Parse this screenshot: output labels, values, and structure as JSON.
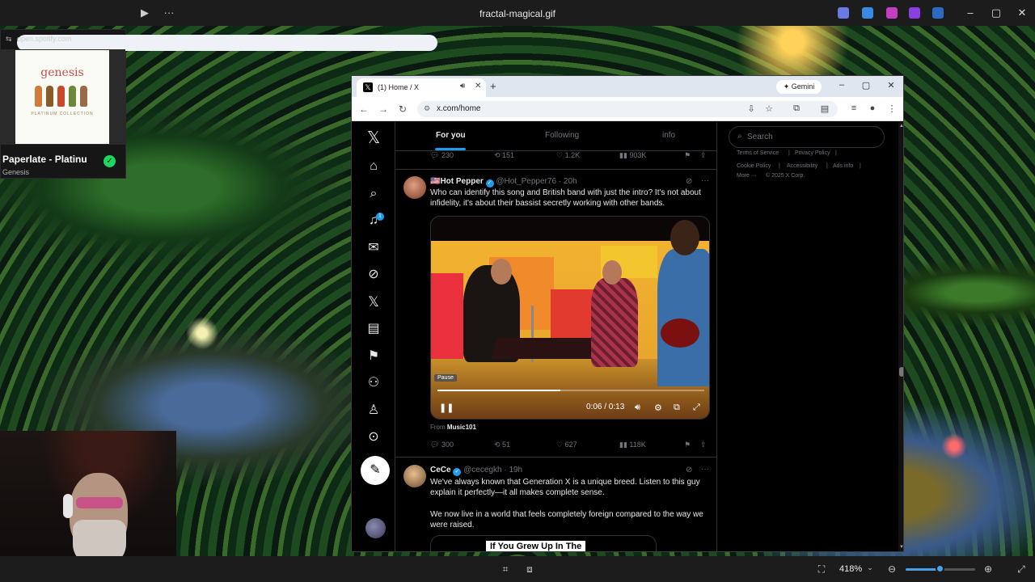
{
  "viewer": {
    "file_name": "fractal-magical.gif",
    "zoom": "418%",
    "zoom_level": 0.5
  },
  "spotify": {
    "url": "open.spotify.com",
    "album_logo": "genesis",
    "album_sub": "PLATINUM COLLECTION",
    "song": "Paperlate - Platinu",
    "artist": "Genesis"
  },
  "browser": {
    "tab_title": "(1) Home / X",
    "url": "x.com/home",
    "gemini": "Gemini"
  },
  "x": {
    "notification_count": "1",
    "tabs": [
      "For you",
      "Following",
      "info"
    ],
    "prev_post_stats": {
      "replies": "230",
      "reposts": "151",
      "likes": "1.2K",
      "views": "903K"
    },
    "post1": {
      "flag": "🇺🇸",
      "name": "Hot Pepper",
      "handle": "@Hot_Pepper76",
      "time": "20h",
      "text": "Who can identify this song and British band with just the intro? It's not about infidelity, it's about their bassist secretly working with other bands.",
      "video": {
        "pause_tooltip": "Pause",
        "time": "0:06 / 0:13",
        "progress": 0.46
      },
      "from_label": "From",
      "from_source": "Music101",
      "stats": {
        "replies": "300",
        "reposts": "51",
        "likes": "627",
        "views": "118K"
      }
    },
    "post2": {
      "name": "CeCe",
      "handle": "@cecegkh",
      "time": "19h",
      "text1": "We've always known that Generation X is a unique breed. Listen to this guy explain it perfectly—it all makes complete sense.",
      "text2": "We now live in a world that feels completely foreign compared to the way we were raised.",
      "card_banner": "If You Grew Up In The"
    },
    "search_placeholder": "Search",
    "footer": {
      "terms": "Terms of Service",
      "privacy": "Privacy Policy",
      "cookie": "Cookie Policy",
      "accessibility": "Accessibility",
      "ads": "Ads info",
      "more": "More ···",
      "copyright": "© 2025 X Corp."
    }
  },
  "colors": {
    "x_blue": "#1d9bf0",
    "spotify_green": "#1ed760"
  }
}
